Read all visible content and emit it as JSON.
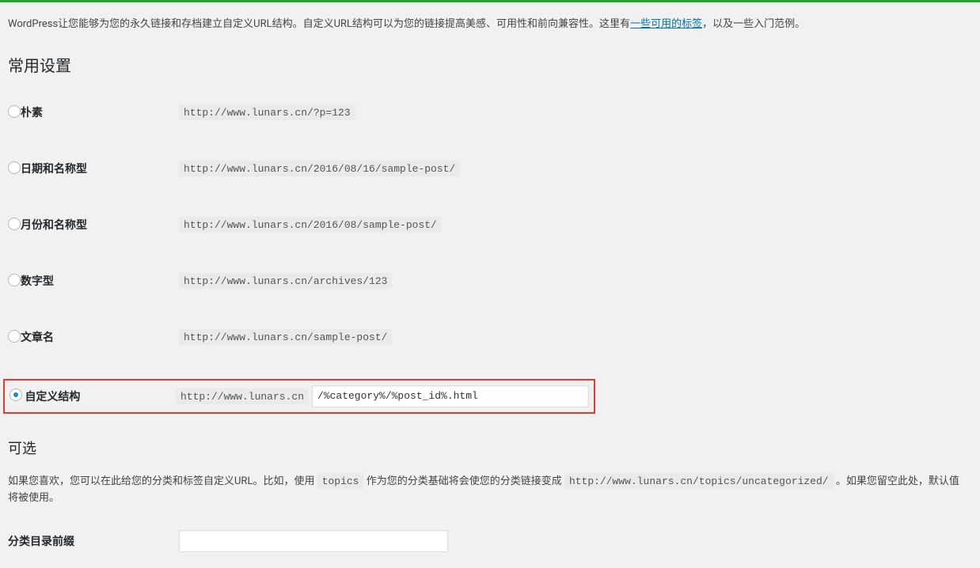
{
  "intro": {
    "part1": "WordPress让您能够为您的永久链接和存档建立自定义URL结构。自定义URL结构可以为您的链接提高美感、可用性和前向兼容性。这里有",
    "link_text": "一些可用的标签",
    "part2": "，以及一些入门范例。"
  },
  "sections": {
    "common_settings": "常用设置",
    "optional": "可选"
  },
  "options": [
    {
      "label": "朴素",
      "example": "http://www.lunars.cn/?p=123"
    },
    {
      "label": "日期和名称型",
      "example": "http://www.lunars.cn/2016/08/16/sample-post/"
    },
    {
      "label": "月份和名称型",
      "example": "http://www.lunars.cn/2016/08/sample-post/"
    },
    {
      "label": "数字型",
      "example": "http://www.lunars.cn/archives/123"
    },
    {
      "label": "文章名",
      "example": "http://www.lunars.cn/sample-post/"
    }
  ],
  "custom": {
    "label": "自定义结构",
    "base": "http://www.lunars.cn",
    "value": "/%category%/%post_id%.html"
  },
  "optional_desc": {
    "p1": "如果您喜欢，您可以在此给您的分类和标签自定义URL。比如，使用 ",
    "topics": "topics",
    "p2": " 作为您的分类基础将会使您的分类链接变成 ",
    "example": "http://www.lunars.cn/topics/uncategorized/",
    "p3": " 。如果您留空此处，默认值将被使用。"
  },
  "category_prefix_label": "分类目录前缀"
}
